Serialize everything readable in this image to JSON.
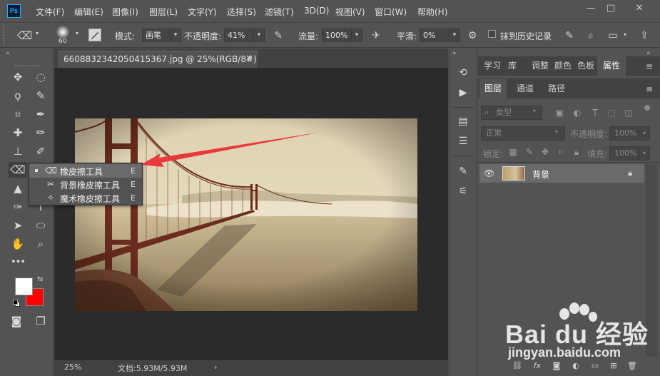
{
  "app": {
    "logo_text": "Ps"
  },
  "menubar": {
    "items": [
      "文件(F)",
      "编辑(E)",
      "图像(I)",
      "图层(L)",
      "文字(Y)",
      "选择(S)",
      "滤镜(T)",
      "3D(D)",
      "视图(V)",
      "窗口(W)",
      "帮助(H)"
    ],
    "minimize": "—",
    "maximize": "□",
    "close": "✕"
  },
  "options": {
    "brush_size": "60",
    "mode_label": "模式:",
    "mode_value": "画笔",
    "opacity_label": "不透明度:",
    "opacity_value": "41%",
    "flow_label": "流量:",
    "flow_value": "100%",
    "smoothing_label": "平滑:",
    "smoothing_value": "0%",
    "erase_history_label": "抹到历史记录"
  },
  "document": {
    "tab_title": "6608832342050415367.jpg @ 25%(RGB/8#)",
    "close": "×",
    "zoom": "25%",
    "doc_info": "文档:5.93M/5.93M",
    "status_arrow": "›"
  },
  "flyout": {
    "items": [
      {
        "label": "橡皮擦工具",
        "key": "E",
        "icon": "eraser-icon"
      },
      {
        "label": "背景橡皮擦工具",
        "key": "E",
        "icon": "background-eraser-icon"
      },
      {
        "label": "魔术橡皮擦工具",
        "key": "E",
        "icon": "magic-eraser-icon"
      }
    ]
  },
  "top_panel": {
    "tabs": [
      "学习",
      "库",
      "调整",
      "颜色",
      "色板",
      "属性"
    ],
    "active": "属性"
  },
  "layers_panel": {
    "tabs": [
      "图层",
      "通道",
      "路径"
    ],
    "active": "图层",
    "filter_kind": "类型",
    "blend_mode": "正常",
    "opacity_label": "不透明度:",
    "opacity_value": "100%",
    "lock_label": "锁定:",
    "fill_label": "填充:",
    "fill_value": "100%",
    "layers": [
      {
        "name": "背景",
        "visible": true,
        "locked": true
      }
    ]
  },
  "watermark": {
    "brand": "Bai du 经验",
    "url": "jingyan.baidu.com"
  },
  "colors": {
    "foreground": "#ffffff",
    "background": "#ff0000",
    "arrow": "#e83a3a",
    "ui_bg": "#535353",
    "canvas_bg": "#2b2b2b"
  }
}
